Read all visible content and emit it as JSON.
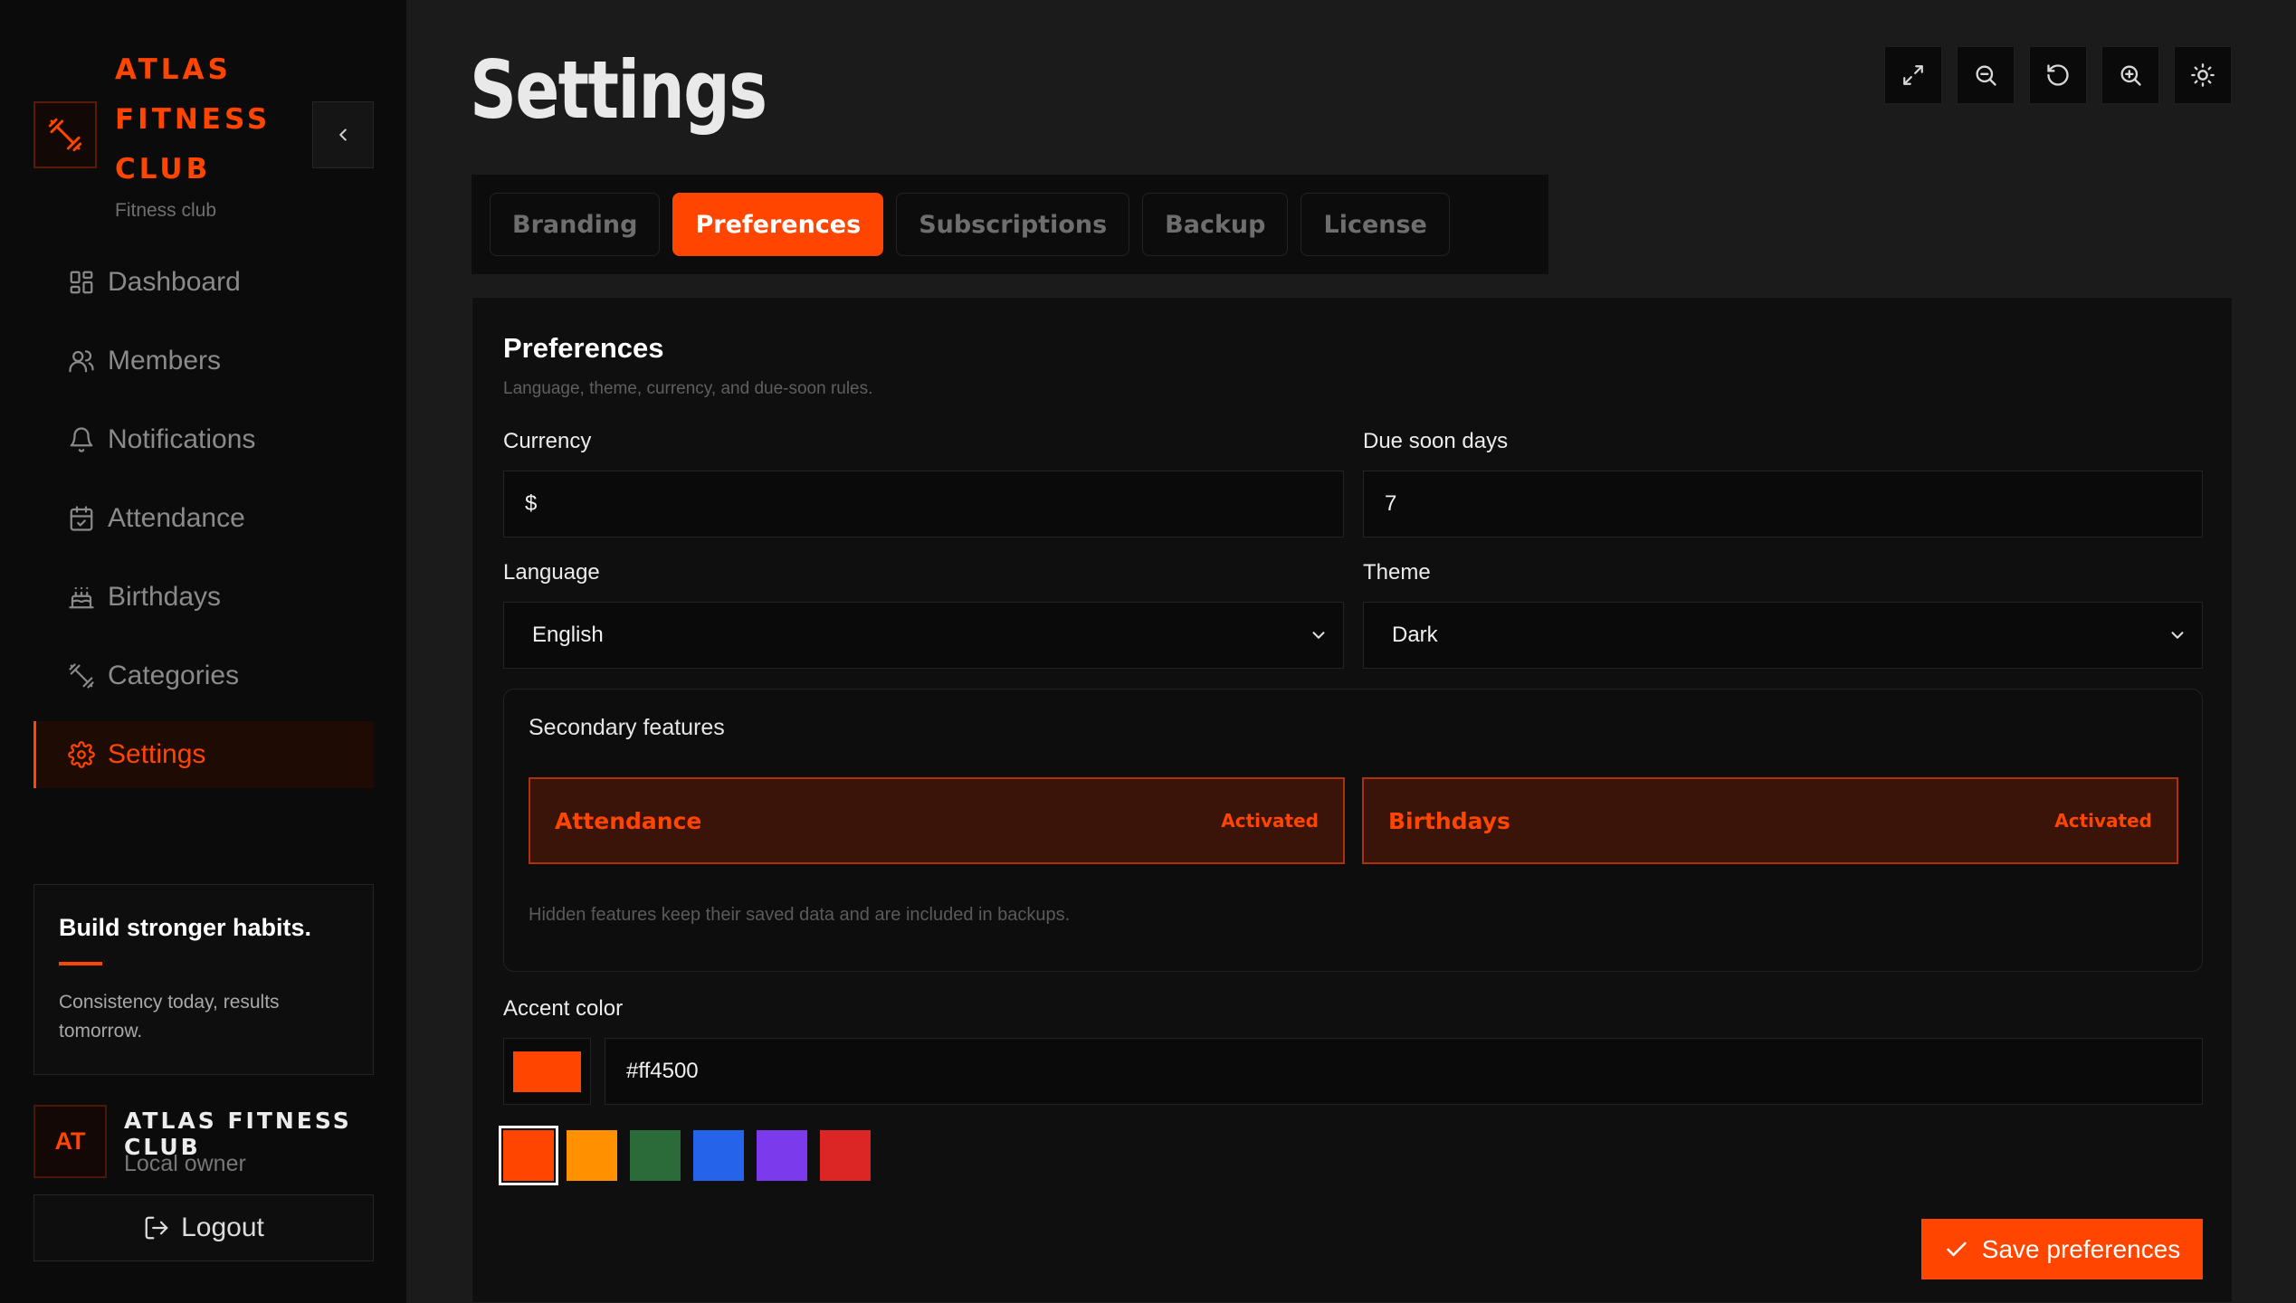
{
  "brand": {
    "name": "ATLAS\nFITNESS\nCLUB",
    "subtitle": "Fitness club",
    "accent": "#ff4500"
  },
  "sidebar": {
    "items": [
      {
        "label": "Dashboard",
        "icon": "dashboard-icon"
      },
      {
        "label": "Members",
        "icon": "members-icon"
      },
      {
        "label": "Notifications",
        "icon": "bell-icon"
      },
      {
        "label": "Attendance",
        "icon": "calendar-icon"
      },
      {
        "label": "Birthdays",
        "icon": "cake-icon"
      },
      {
        "label": "Categories",
        "icon": "dumbbell-icon"
      },
      {
        "label": "Settings",
        "icon": "gear-icon",
        "active": true
      }
    ],
    "quote": {
      "title": "Build stronger habits.",
      "text": "Consistency today, results tomorrow."
    },
    "user": {
      "initials": "AT",
      "name": "ATLAS FITNESS CLUB",
      "role": "Local owner"
    },
    "logout_label": "Logout"
  },
  "header": {
    "title": "Settings",
    "toolbar": [
      "expand-icon",
      "zoom-out-icon",
      "reset-icon",
      "zoom-in-icon",
      "sun-icon"
    ]
  },
  "tabs": [
    {
      "label": "Branding"
    },
    {
      "label": "Preferences",
      "active": true
    },
    {
      "label": "Subscriptions"
    },
    {
      "label": "Backup"
    },
    {
      "label": "License"
    }
  ],
  "preferences": {
    "title": "Preferences",
    "subtitle": "Language, theme, currency, and due-soon rules.",
    "currency": {
      "label": "Currency",
      "value": "$"
    },
    "due_soon": {
      "label": "Due soon days",
      "value": "7"
    },
    "language": {
      "label": "Language",
      "value": "English"
    },
    "theme": {
      "label": "Theme",
      "value": "Dark"
    },
    "secondary": {
      "title": "Secondary features",
      "features": [
        {
          "name": "Attendance",
          "status": "Activated"
        },
        {
          "name": "Birthdays",
          "status": "Activated"
        }
      ],
      "note": "Hidden features keep their saved data and are included in backups."
    },
    "accent": {
      "label": "Accent color",
      "value": "#ff4500",
      "swatches": [
        "#ff4500",
        "#ff9000",
        "#2b6b39",
        "#2563eb",
        "#7c3aed",
        "#dc2626"
      ]
    },
    "save_label": "Save preferences"
  }
}
